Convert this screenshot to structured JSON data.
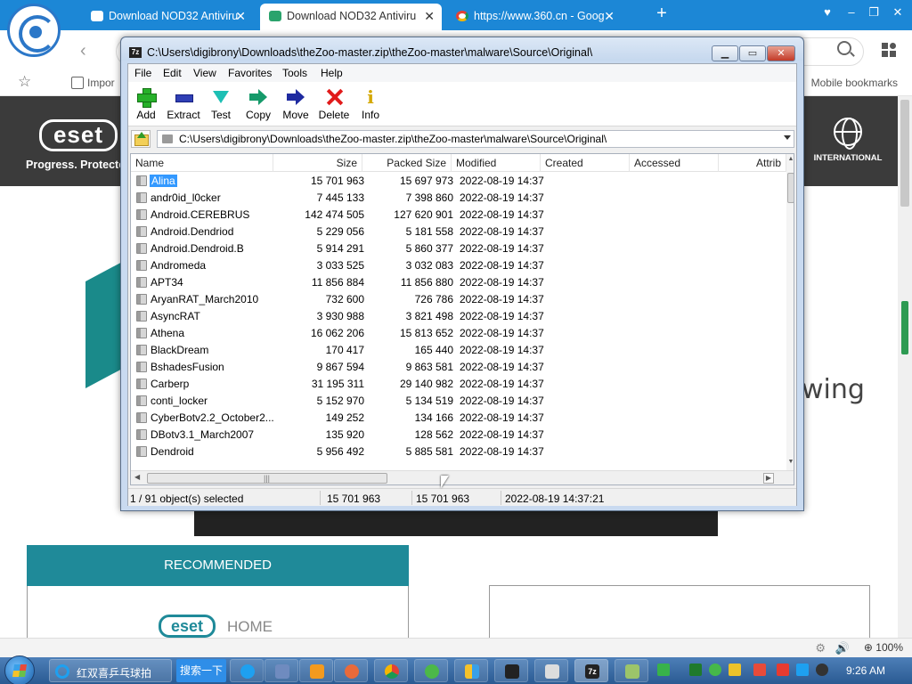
{
  "browser": {
    "tabs": [
      {
        "title": "Download NOD32 Antiviru",
        "close": "✕"
      },
      {
        "title": "Download NOD32 Antiviru",
        "close": "✕"
      },
      {
        "title": "https://www.360.cn - Goog",
        "close": "✕"
      }
    ],
    "new_tab": "+",
    "bookmarks": {
      "import_label": "Impor",
      "mobile_label": "Mobile bookmarks"
    },
    "zoom": "100%"
  },
  "eset_page": {
    "logo": "eset",
    "tagline": "Progress. Protecte",
    "international": "INTERNATIONAL",
    "wing": "wing",
    "recommended": "RECOMMENDED",
    "home_logo": "eset",
    "home_label": "HOME"
  },
  "sevenzip": {
    "title": "C:\\Users\\digibrony\\Downloads\\theZoo-master.zip\\theZoo-master\\malware\\Source\\Original\\",
    "app_icon_text": "7z",
    "menu": [
      "File",
      "Edit",
      "View",
      "Favorites",
      "Tools",
      "Help"
    ],
    "toolbar": [
      "Add",
      "Extract",
      "Test",
      "Copy",
      "Move",
      "Delete",
      "Info"
    ],
    "info_glyph": "i",
    "path": "C:\\Users\\digibrony\\Downloads\\theZoo-master.zip\\theZoo-master\\malware\\Source\\Original\\",
    "columns": [
      "Name",
      "Size",
      "Packed Size",
      "Modified",
      "Created",
      "Accessed",
      "Attrib"
    ],
    "rows": [
      {
        "name": "Alina",
        "size": "15 701 963",
        "packed": "15 697 973",
        "modified": "2022-08-19 14:37"
      },
      {
        "name": "andr0id_l0cker",
        "size": "7 445 133",
        "packed": "7 398 860",
        "modified": "2022-08-19 14:37"
      },
      {
        "name": "Android.CEREBRUS",
        "size": "142 474 505",
        "packed": "127 620 901",
        "modified": "2022-08-19 14:37"
      },
      {
        "name": "Android.Dendriod",
        "size": "5 229 056",
        "packed": "5 181 558",
        "modified": "2022-08-19 14:37"
      },
      {
        "name": "Android.Dendroid.B",
        "size": "5 914 291",
        "packed": "5 860 377",
        "modified": "2022-08-19 14:37"
      },
      {
        "name": "Andromeda",
        "size": "3 033 525",
        "packed": "3 032 083",
        "modified": "2022-08-19 14:37"
      },
      {
        "name": "APT34",
        "size": "11 856 884",
        "packed": "11 856 880",
        "modified": "2022-08-19 14:37"
      },
      {
        "name": "AryanRAT_March2010",
        "size": "732 600",
        "packed": "726 786",
        "modified": "2022-08-19 14:37"
      },
      {
        "name": "AsyncRAT",
        "size": "3 930 988",
        "packed": "3 821 498",
        "modified": "2022-08-19 14:37"
      },
      {
        "name": "Athena",
        "size": "16 062 206",
        "packed": "15 813 652",
        "modified": "2022-08-19 14:37"
      },
      {
        "name": "BlackDream",
        "size": "170 417",
        "packed": "165 440",
        "modified": "2022-08-19 14:37"
      },
      {
        "name": "BshadesFusion",
        "size": "9 867 594",
        "packed": "9 863 581",
        "modified": "2022-08-19 14:37"
      },
      {
        "name": "Carberp",
        "size": "31 195 311",
        "packed": "29 140 982",
        "modified": "2022-08-19 14:37"
      },
      {
        "name": "conti_locker",
        "size": "5 152 970",
        "packed": "5 134 519",
        "modified": "2022-08-19 14:37"
      },
      {
        "name": "CyberBotv2.2_October2...",
        "size": "149 252",
        "packed": "134 166",
        "modified": "2022-08-19 14:37"
      },
      {
        "name": "DBotv3.1_March2007",
        "size": "135 920",
        "packed": "128 562",
        "modified": "2022-08-19 14:37"
      },
      {
        "name": "Dendroid",
        "size": "5 956 492",
        "packed": "5 885 581",
        "modified": "2022-08-19 14:37"
      }
    ],
    "status": {
      "selection": "1 / 91 object(s) selected",
      "size": "15 701 963",
      "packed": "15 701 963",
      "modified": "2022-08-19 14:37:21"
    }
  },
  "taskbar": {
    "ie_label": "红双喜乒乓球拍",
    "search_label": "搜索一下",
    "time": "9:26 AM"
  }
}
